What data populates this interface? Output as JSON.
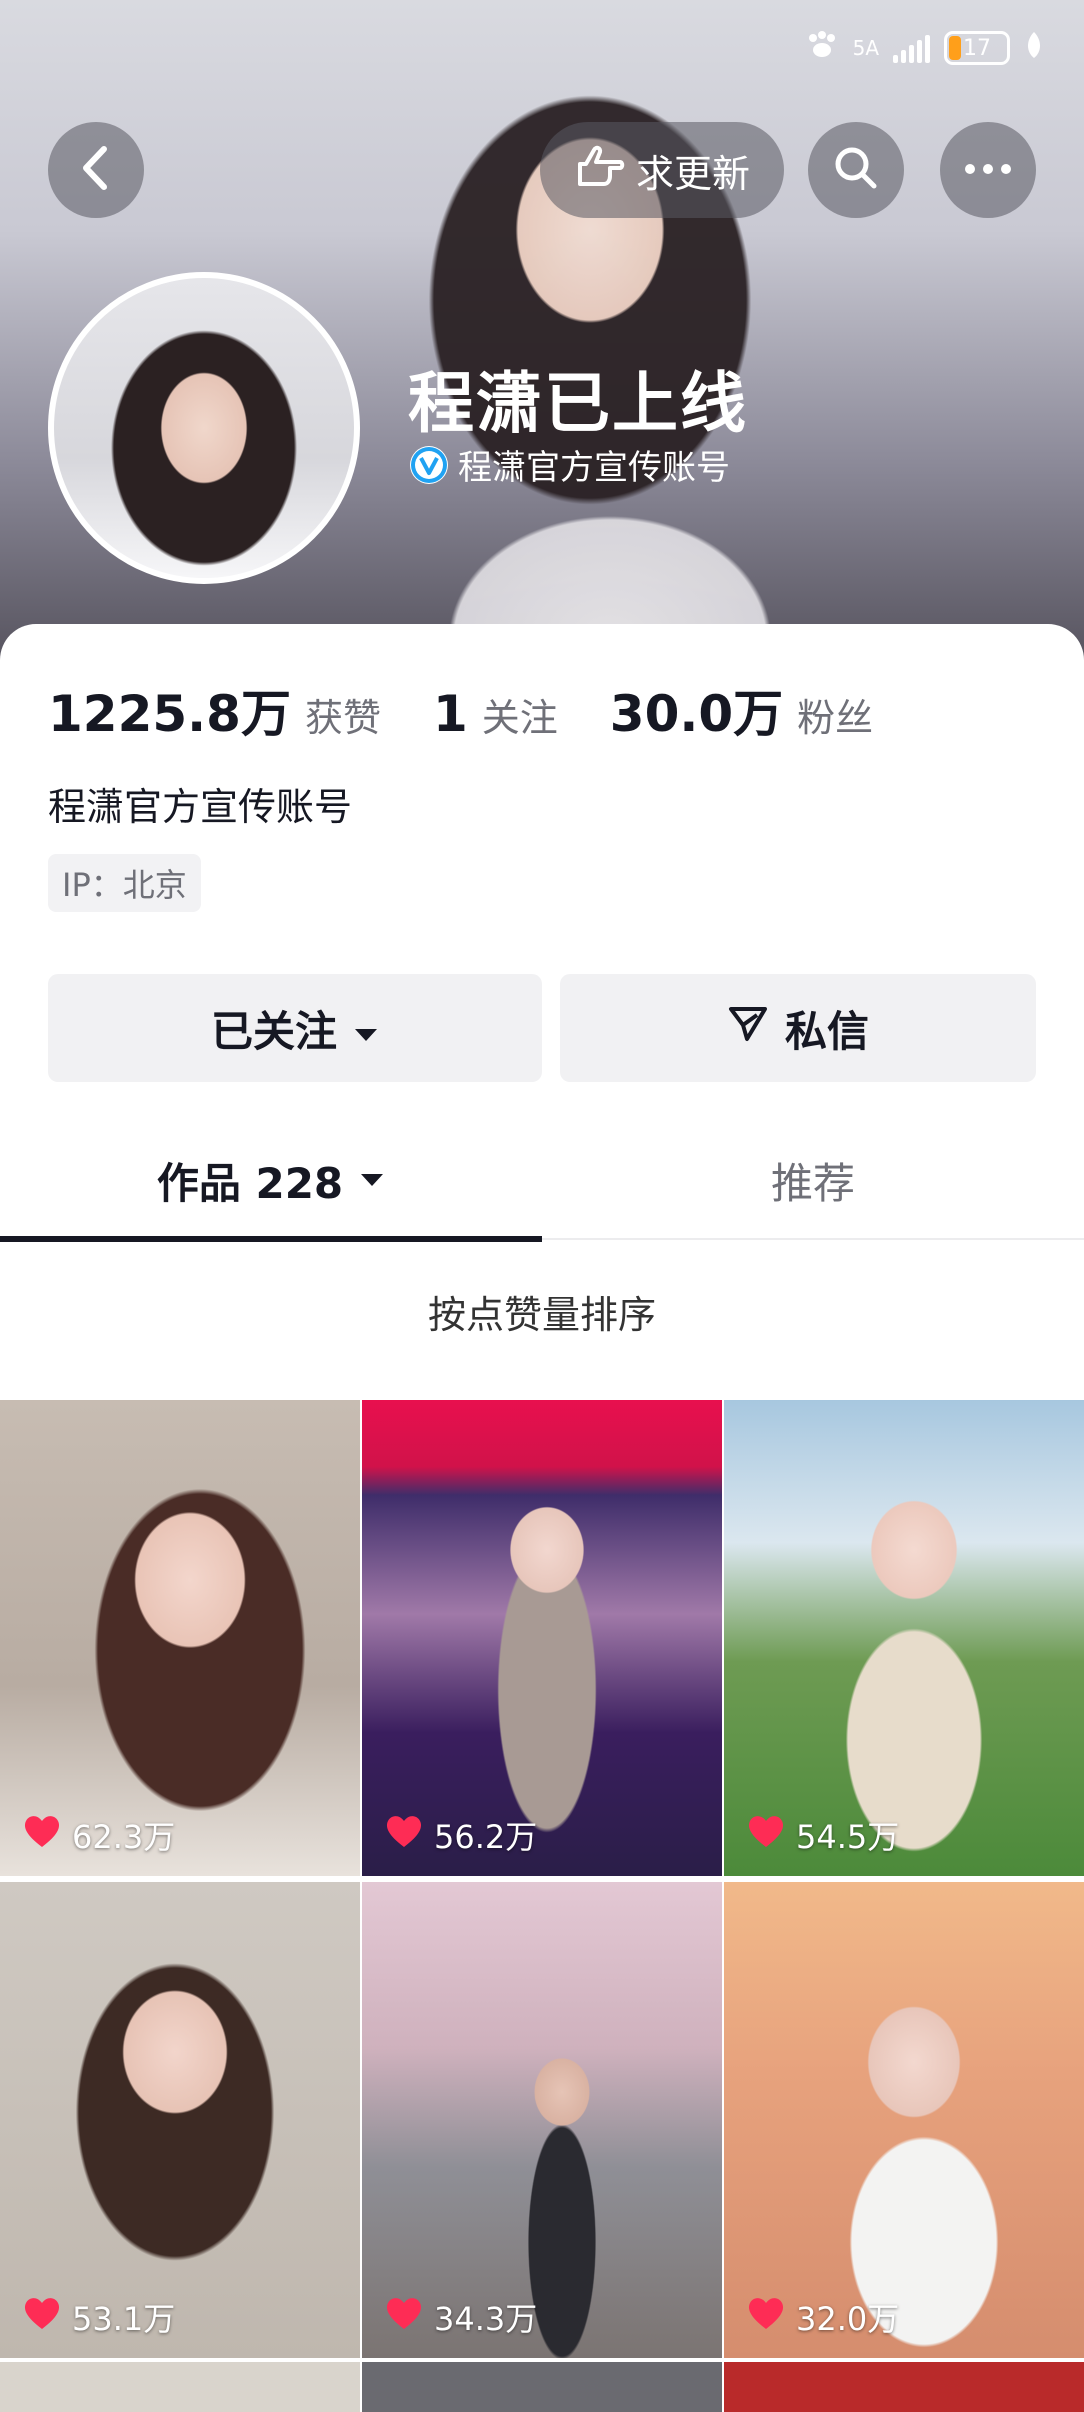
{
  "status_bar": {
    "network": "5A",
    "battery": "17"
  },
  "header": {
    "request_update_label": "求更新",
    "name": "程潇已上线",
    "verified_text": "程潇官方宣传账号"
  },
  "stats": [
    {
      "value": "1225.8万",
      "label": "获赞"
    },
    {
      "value": "1",
      "label": "关注"
    },
    {
      "value": "30.0万",
      "label": "粉丝"
    }
  ],
  "bio": "程潇官方宣传账号",
  "ip_tag": "IP：北京",
  "actions": {
    "followed_label": "已关注",
    "message_label": "私信"
  },
  "tabs": [
    {
      "label": "作品 228",
      "active": true
    },
    {
      "label": "推荐",
      "active": false
    }
  ],
  "sort_label": "按点赞量排序",
  "videos": [
    {
      "likes": "62.3万"
    },
    {
      "likes": "56.2万"
    },
    {
      "likes": "54.5万"
    },
    {
      "likes": "53.1万"
    },
    {
      "likes": "34.3万"
    },
    {
      "likes": "32.0万"
    }
  ],
  "icons": [
    "back-icon",
    "hand-point-icon",
    "search-icon",
    "more-icon",
    "verified-icon",
    "caret-down-icon",
    "send-icon",
    "heart-icon"
  ],
  "colors": {
    "accent_verified": "#20a2f2",
    "heart": "#fe2c55",
    "battery": "#ff9f1a",
    "text_primary": "#161823",
    "text_secondary": "#6f7078"
  }
}
